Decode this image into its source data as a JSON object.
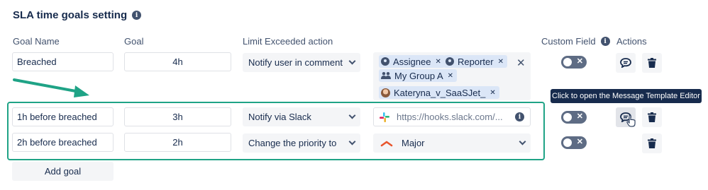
{
  "section": {
    "title": "SLA time goals setting"
  },
  "headers": {
    "goal_name": "Goal Name",
    "goal": "Goal",
    "limit_action": "Limit Exceeded action",
    "custom_field": "Custom Field",
    "actions": "Actions"
  },
  "rows": [
    {
      "name": "Breached",
      "goal": "4h",
      "action": "Notify user in comment",
      "chips": [
        {
          "label": "Assignee",
          "icon": "user-icon"
        },
        {
          "label": "Reporter",
          "icon": "user-icon"
        },
        {
          "label": "My Group A",
          "icon": "group-icon"
        },
        {
          "label": "Kateryna_v_SaaSJet_",
          "icon": "avatar-photo"
        }
      ],
      "toggle": "✕"
    },
    {
      "name": "1h before breached",
      "goal": "3h",
      "action": "Notify via Slack",
      "slack_url": "https://hooks.slack.com/...",
      "toggle": "✕"
    },
    {
      "name": "2h before breached",
      "goal": "2h",
      "action": "Change the priority to",
      "priority": "Major",
      "toggle": "✕"
    }
  ],
  "tooltip": "Click to open the Message Template Editor",
  "add_goal": "Add goal",
  "colors": {
    "accent_green": "#1fa386",
    "chip_blue": "#dbe6f7",
    "priority_major": "#e8552c"
  }
}
